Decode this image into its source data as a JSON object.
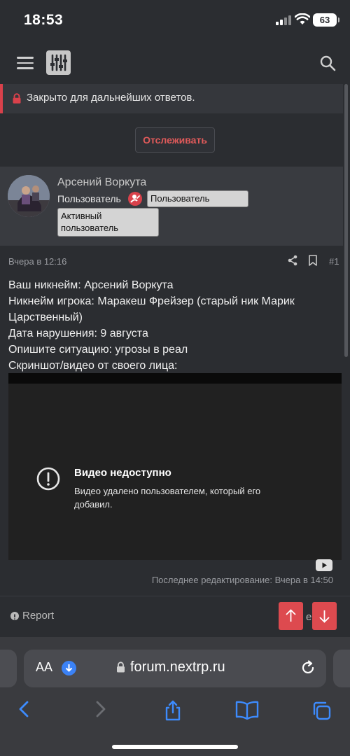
{
  "status_bar": {
    "time": "18:53",
    "battery": "63"
  },
  "notice": {
    "text": "Закрыто для дальнейших ответов."
  },
  "follow_button": "Отслеживать",
  "author": {
    "name": "Арсений Воркута",
    "role": "Пользователь",
    "badges": [
      "Пользователь",
      "Активный пользователь"
    ]
  },
  "post": {
    "date": "Вчера в 12:16",
    "number": "#1",
    "lines": [
      "Ваш никнейм: Арсений Воркута",
      "Никнейм игрока: Маракеш Фрейзер (старый ник Марик Царственный)",
      "Дата нарушения: 9 августа",
      "Опишите ситуацию: угрозы в реал",
      "Скриншот/видео от своего лица:"
    ],
    "video": {
      "title": "Видео недоступно",
      "description": "Видео удалено пользователем, который его добавил."
    },
    "edit_note": "Последнее редактирование: Вчера в 14:50"
  },
  "actions": {
    "report": "Report",
    "like": "e"
  },
  "browser": {
    "aa_label": "AA",
    "url": "forum.nextrp.ru"
  },
  "colors": {
    "accent": "#dd4a4f",
    "background": "#2b2d31",
    "panel": "#393b40"
  },
  "icons": [
    "menu-icon",
    "logo-icon",
    "search-icon",
    "lock-icon",
    "share-icon",
    "bookmark-icon",
    "alert-icon",
    "youtube-icon",
    "report-icon",
    "arrow-up-icon",
    "arrow-down-icon",
    "download-icon",
    "reload-icon",
    "back-icon",
    "forward-icon",
    "share-sheet-icon",
    "bookmarks-icon",
    "tabs-icon"
  ]
}
